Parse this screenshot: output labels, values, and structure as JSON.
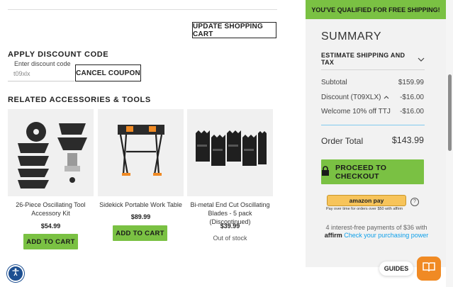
{
  "cart": {
    "update_label": "UPDATE SHOPPING CART"
  },
  "discount": {
    "heading": "APPLY DISCOUNT CODE",
    "field_label": "Enter discount code",
    "field_value": "t09xlx",
    "cancel_label": "CANCEL COUPON"
  },
  "related": {
    "heading": "RELATED ACCESSORIES & TOOLS",
    "items": [
      {
        "title_line1": "26-Piece Oscillating Tool",
        "title_line2": "Accessory Kit",
        "price": "$54.99",
        "action": "ADD TO CART"
      },
      {
        "title_line1": "Sidekick Portable Work Table",
        "title_line2": "",
        "price": "$89.99",
        "action": "ADD TO CART"
      },
      {
        "title_line1": "Bi-metal End Cut Oscillating",
        "title_line2": "Blades - 5 pack (Discontinued)",
        "price": "$39.99",
        "status": "Out of stock"
      }
    ]
  },
  "summary": {
    "banner": "YOU'VE QUALIFIED FOR FREE SHIPPING!",
    "title": "SUMMARY",
    "estimate_label": "ESTIMATE SHIPPING AND TAX",
    "rows": [
      {
        "label": "Subtotal",
        "value": "$159.99"
      },
      {
        "label": "Discount (T09XLX)",
        "value": "-$16.00"
      },
      {
        "label": "Welcome 10% off TTJ",
        "value": "-$16.00"
      }
    ],
    "total_label": "Order Total",
    "total_value": "$143.99",
    "checkout_label": "PROCEED TO CHECKOUT",
    "amazon_pay_label": "amazon pay",
    "amazon_pay_note": "Pay over time for orders over $50 with affirm",
    "affirm_line1": "4 interest-free payments of $36 with",
    "affirm_brand": "affirm",
    "affirm_link": "Check your purchasing power"
  },
  "guides": {
    "label": "GUIDES"
  },
  "colors": {
    "accent_green": "#7ac143",
    "amazon_yellow": "#f7c45a",
    "affirm_blue": "#0fa0ea",
    "guides_orange": "#f08a24"
  }
}
